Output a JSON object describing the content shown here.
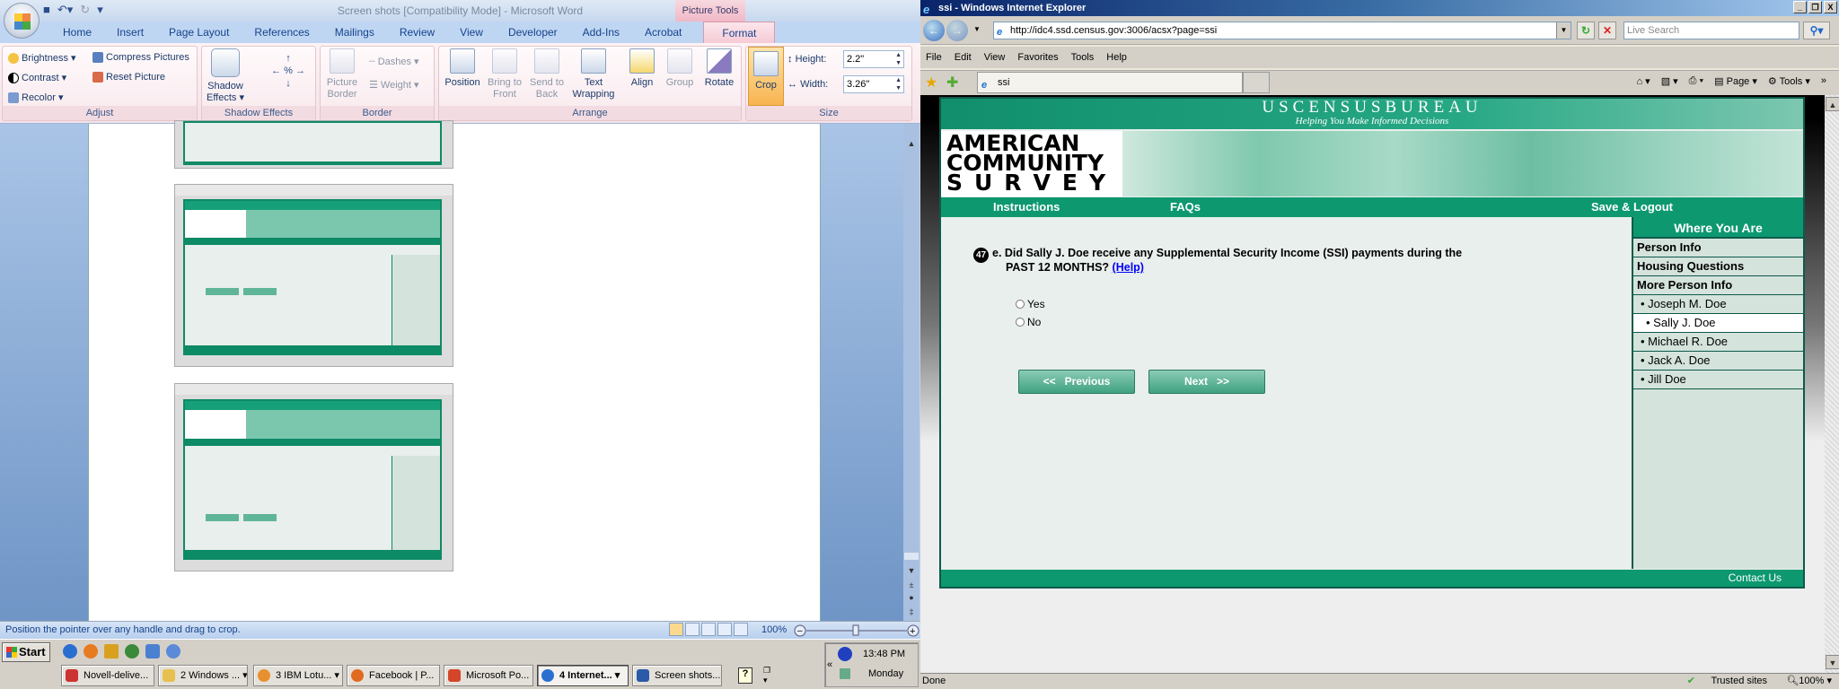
{
  "word": {
    "title": "Screen shots [Compatibility Mode] - Microsoft Word",
    "context_tab": "Picture Tools",
    "tabs": [
      "Home",
      "Insert",
      "Page Layout",
      "References",
      "Mailings",
      "Review",
      "View",
      "Developer",
      "Add-Ins",
      "Acrobat",
      "Format"
    ],
    "active_tab": "Format",
    "ribbon": {
      "adjust": {
        "label": "Adjust",
        "brightness": "Brightness",
        "contrast": "Contrast",
        "recolor": "Recolor",
        "compress": "Compress Pictures",
        "reset": "Reset Picture"
      },
      "shadow": {
        "label": "Shadow Effects",
        "shadow_effects": "Shadow Effects"
      },
      "border": {
        "label": "Border",
        "picture_border": "Picture Border",
        "dashes": "Dashes",
        "weight": "Weight"
      },
      "arrange": {
        "label": "Arrange",
        "position": "Position",
        "bring_to_front": "Bring to Front",
        "send_to_back": "Send to Back",
        "text_wrapping": "Text Wrapping",
        "align": "Align",
        "group": "Group",
        "rotate": "Rotate"
      },
      "size": {
        "label": "Size",
        "crop": "Crop",
        "height_label": "Height:",
        "height_value": "2.2\"",
        "width_label": "Width:",
        "width_value": "3.26\""
      }
    },
    "status": "Position the pointer over any handle and drag to crop.",
    "zoom": "100%"
  },
  "taskbar": {
    "start": "Start",
    "tasks": [
      "Novell-delive...",
      "2 Windows ...",
      "3 IBM Lotu...",
      "Facebook | P...",
      "Microsoft Po...",
      "4 Internet...",
      "Screen shots..."
    ],
    "active_task": "4 Internet...",
    "time": "13:48 PM",
    "day": "Monday"
  },
  "ie": {
    "title": "ssi - Windows Internet Explorer",
    "url": "http://idc4.ssd.census.gov:3006/acsx?page=ssi",
    "search_placeholder": "Live Search",
    "menu": [
      "File",
      "Edit",
      "View",
      "Favorites",
      "Tools",
      "Help"
    ],
    "tab": "ssi",
    "commands": {
      "page": "Page",
      "tools": "Tools"
    },
    "status": "Done",
    "zone": "Trusted sites",
    "zoom": "100%"
  },
  "census": {
    "bureau": "USCENSUSBUREAU",
    "tagline": "Helping You Make Informed Decisions",
    "logo": [
      "AMERICAN",
      "COMMUNITY",
      "SURVEY"
    ],
    "nav": {
      "instructions": "Instructions",
      "faqs": "FAQs",
      "save_logout": "Save & Logout"
    },
    "question": {
      "number": "47",
      "line1": "e. Did Sally J. Doe receive any Supplemental Security Income (SSI) payments during the",
      "line2": "PAST 12 MONTHS?",
      "help": "(Help)",
      "options": [
        "Yes",
        "No"
      ]
    },
    "buttons": {
      "previous": "<<   Previous",
      "next": "Next   >>"
    },
    "sidebar": {
      "header": "Where You Are",
      "sections": [
        "Person Info",
        "Housing Questions",
        "More Person Info"
      ],
      "people": [
        "• Joseph M. Doe",
        "• Sally J. Doe",
        "• Michael R. Doe",
        "• Jack A. Doe",
        "• Jill Doe"
      ],
      "current": "• Sally J. Doe"
    },
    "footer": "Contact Us",
    "colors": {
      "green": "#0d9870",
      "dark": "#0d5a4a",
      "page_bg": "#e9efec"
    }
  }
}
